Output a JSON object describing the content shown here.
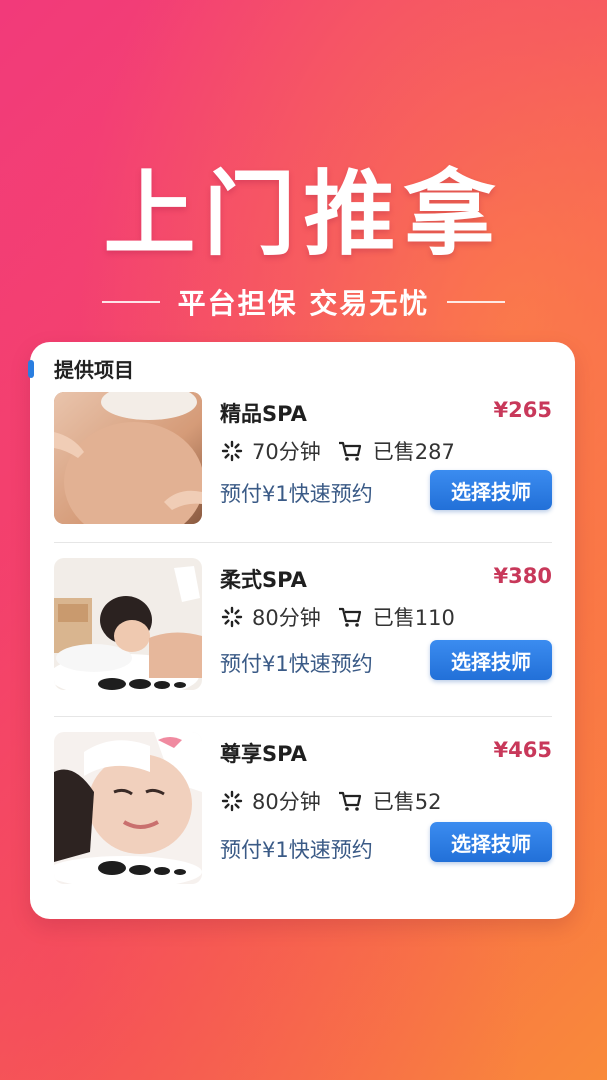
{
  "hero": {
    "title": "上门推拿",
    "subtitle": "平台担保 交易无忧"
  },
  "card": {
    "heading": "提供项目"
  },
  "items": [
    {
      "name": "精品SPA",
      "price": "¥265",
      "duration": "70分钟",
      "sold": "已售287",
      "prepay": "预付¥1快速预约",
      "button": "选择技师"
    },
    {
      "name": "柔式SPA",
      "price": "¥380",
      "duration": "80分钟",
      "sold": "已售110",
      "prepay": "预付¥1快速预约",
      "button": "选择技师"
    },
    {
      "name": "尊享SPA",
      "price": "¥465",
      "duration": "80分钟",
      "sold": "已售52",
      "prepay": "预付¥1快速预约",
      "button": "选择技师"
    }
  ],
  "icons": {
    "duration": "clock-spinner-icon",
    "sold": "cart-icon"
  },
  "colors": {
    "price": "#c8385a",
    "button": "#2a7ee0",
    "prepay_text": "#3a5a86"
  }
}
